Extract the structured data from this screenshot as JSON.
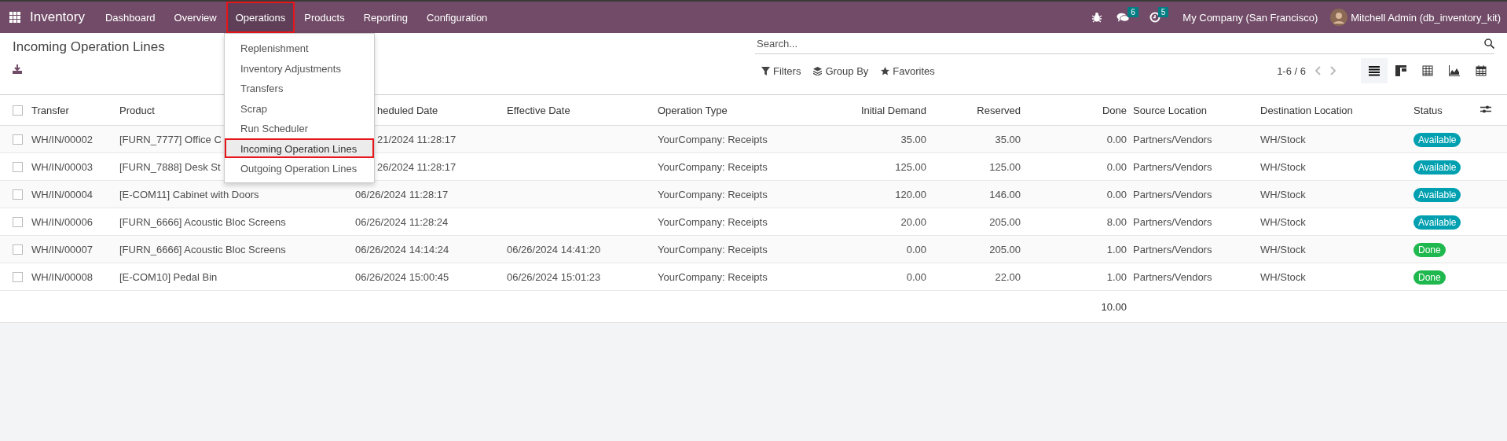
{
  "navbar": {
    "app_name": "Inventory",
    "menu": [
      {
        "label": "Dashboard",
        "selected": false,
        "highlighted": false
      },
      {
        "label": "Overview",
        "selected": false,
        "highlighted": false
      },
      {
        "label": "Operations",
        "selected": true,
        "highlighted": true
      },
      {
        "label": "Products",
        "selected": false,
        "highlighted": false
      },
      {
        "label": "Reporting",
        "selected": false,
        "highlighted": false
      },
      {
        "label": "Configuration",
        "selected": false,
        "highlighted": false
      }
    ],
    "messages_badge": "6",
    "activities_badge": "5",
    "company": "My Company (San Francisco)",
    "user": "Mitchell Admin (db_inventory_kit)"
  },
  "dropdown": {
    "items": [
      {
        "label": "Replenishment",
        "highlighted": false
      },
      {
        "label": "Inventory Adjustments",
        "highlighted": false
      },
      {
        "label": "Transfers",
        "highlighted": false
      },
      {
        "label": "Scrap",
        "highlighted": false
      },
      {
        "label": "Run Scheduler",
        "highlighted": false
      },
      {
        "label": "Incoming Operation Lines",
        "highlighted": true
      },
      {
        "label": "Outgoing Operation Lines",
        "highlighted": false
      }
    ]
  },
  "control_panel": {
    "title": "Incoming Operation Lines",
    "search": {
      "placeholder": "Search..."
    },
    "filters": [
      {
        "kind": "filter",
        "label": "Filters"
      },
      {
        "kind": "group",
        "label": "Group By"
      },
      {
        "kind": "favorite",
        "label": "Favorites"
      }
    ],
    "pager": "1-6 / 6",
    "views": [
      {
        "kind": "list",
        "selected": true
      },
      {
        "kind": "kanban",
        "selected": false
      },
      {
        "kind": "pivot",
        "selected": false
      },
      {
        "kind": "graph",
        "selected": false
      },
      {
        "kind": "calendar",
        "selected": false
      }
    ]
  },
  "table": {
    "header_checked": false,
    "columns": [
      {
        "label": "Transfer",
        "kind": "text"
      },
      {
        "label": "Product",
        "kind": "text"
      },
      {
        "label": "heduled Date",
        "kind": "text"
      },
      {
        "label": "Effective Date",
        "kind": "text"
      },
      {
        "label": "Operation Type",
        "kind": "text"
      },
      {
        "label": "Initial Demand",
        "kind": "number"
      },
      {
        "label": "Reserved",
        "kind": "number"
      },
      {
        "label": "Done",
        "kind": "number"
      },
      {
        "label": "Source Location",
        "kind": "text"
      },
      {
        "label": "Destination Location",
        "kind": "text"
      },
      {
        "label": "Status",
        "kind": "text"
      }
    ],
    "rows": [
      {
        "checked": false,
        "transfer": "WH/IN/00002",
        "product": "[FURN_7777] Office C",
        "scheduled_date": "21/2024 11:28:17",
        "scheduled_cut": true,
        "operation_type": "YourCompany: Receipts",
        "initial_demand": "35.00",
        "reserved": "35.00",
        "done": "0.00",
        "source": "Partners/Vendors",
        "destination": "WH/Stock",
        "status": {
          "label": "Available",
          "color": "#00a0b0"
        }
      },
      {
        "checked": false,
        "transfer": "WH/IN/00003",
        "product": "[FURN_7888] Desk St",
        "scheduled_date": "26/2024 11:28:17",
        "scheduled_cut": true,
        "operation_type": "YourCompany: Receipts",
        "initial_demand": "125.00",
        "reserved": "125.00",
        "done": "0.00",
        "source": "Partners/Vendors",
        "destination": "WH/Stock",
        "status": {
          "label": "Available",
          "color": "#00a0b0"
        }
      },
      {
        "checked": false,
        "transfer": "WH/IN/00004",
        "product": "[E-COM11] Cabinet with Doors",
        "scheduled_date": "06/26/2024 11:28:17",
        "scheduled_cut": false,
        "operation_type": "YourCompany: Receipts",
        "initial_demand": "120.00",
        "reserved": "146.00",
        "done": "0.00",
        "source": "Partners/Vendors",
        "destination": "WH/Stock",
        "status": {
          "label": "Available",
          "color": "#00a0b0"
        }
      },
      {
        "checked": false,
        "transfer": "WH/IN/00006",
        "product": "[FURN_6666] Acoustic Bloc Screens",
        "scheduled_date": "06/26/2024 11:28:24",
        "scheduled_cut": false,
        "operation_type": "YourCompany: Receipts",
        "initial_demand": "20.00",
        "reserved": "205.00",
        "done": "8.00",
        "source": "Partners/Vendors",
        "destination": "WH/Stock",
        "status": {
          "label": "Available",
          "color": "#00a0b0"
        }
      },
      {
        "checked": false,
        "transfer": "WH/IN/00007",
        "product": "[FURN_6666] Acoustic Bloc Screens",
        "scheduled_date": "06/26/2024 14:14:24",
        "scheduled_cut": false,
        "effective_date": "06/26/2024 14:41:20",
        "operation_type": "YourCompany: Receipts",
        "initial_demand": "0.00",
        "reserved": "205.00",
        "done": "1.00",
        "source": "Partners/Vendors",
        "destination": "WH/Stock",
        "status": {
          "label": "Done",
          "color": "#1fb84e"
        }
      },
      {
        "checked": false,
        "transfer": "WH/IN/00008",
        "product": "[E-COM10] Pedal Bin",
        "scheduled_date": "06/26/2024 15:00:45",
        "scheduled_cut": false,
        "effective_date": "06/26/2024 15:01:23",
        "operation_type": "YourCompany: Receipts",
        "initial_demand": "0.00",
        "reserved": "22.00",
        "done": "1.00",
        "source": "Partners/Vendors",
        "destination": "WH/Stock",
        "status": {
          "label": "Done",
          "color": "#1fb84e"
        }
      }
    ],
    "total_done": "10.00"
  }
}
